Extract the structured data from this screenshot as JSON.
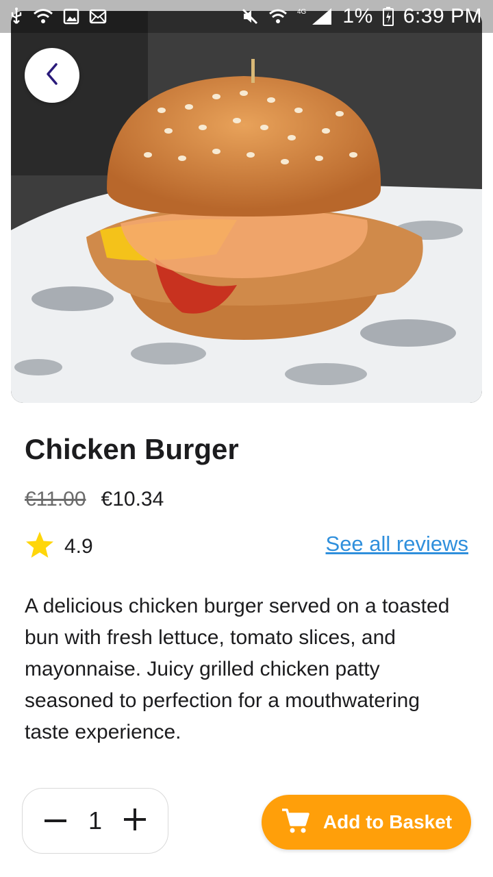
{
  "status_bar": {
    "battery_percent": "1%",
    "time": "6:39 PM",
    "left_icons": [
      "usb-icon",
      "wifi-icon",
      "image-icon",
      "mail-icon"
    ],
    "right_icons": [
      "mute-icon",
      "wifi-icon",
      "lte-signal-icon",
      "battery-icon"
    ]
  },
  "product": {
    "title": "Chicken Burger",
    "old_price": "€11.00",
    "price": "€10.34",
    "rating": "4.9",
    "reviews_link": "See all reviews",
    "description": "A delicious chicken burger served on a toasted bun with fresh lettuce, tomato slices, and mayonnaise. Juicy grilled chicken patty seasoned to perfection for a mouthwatering taste experience."
  },
  "cart": {
    "quantity": "1",
    "add_button_label": "Add to Basket"
  },
  "colors": {
    "accent": "#ff9f0a",
    "link": "#2f8fdc",
    "star": "#ffd60a",
    "back_chevron": "#2a1a7a"
  }
}
